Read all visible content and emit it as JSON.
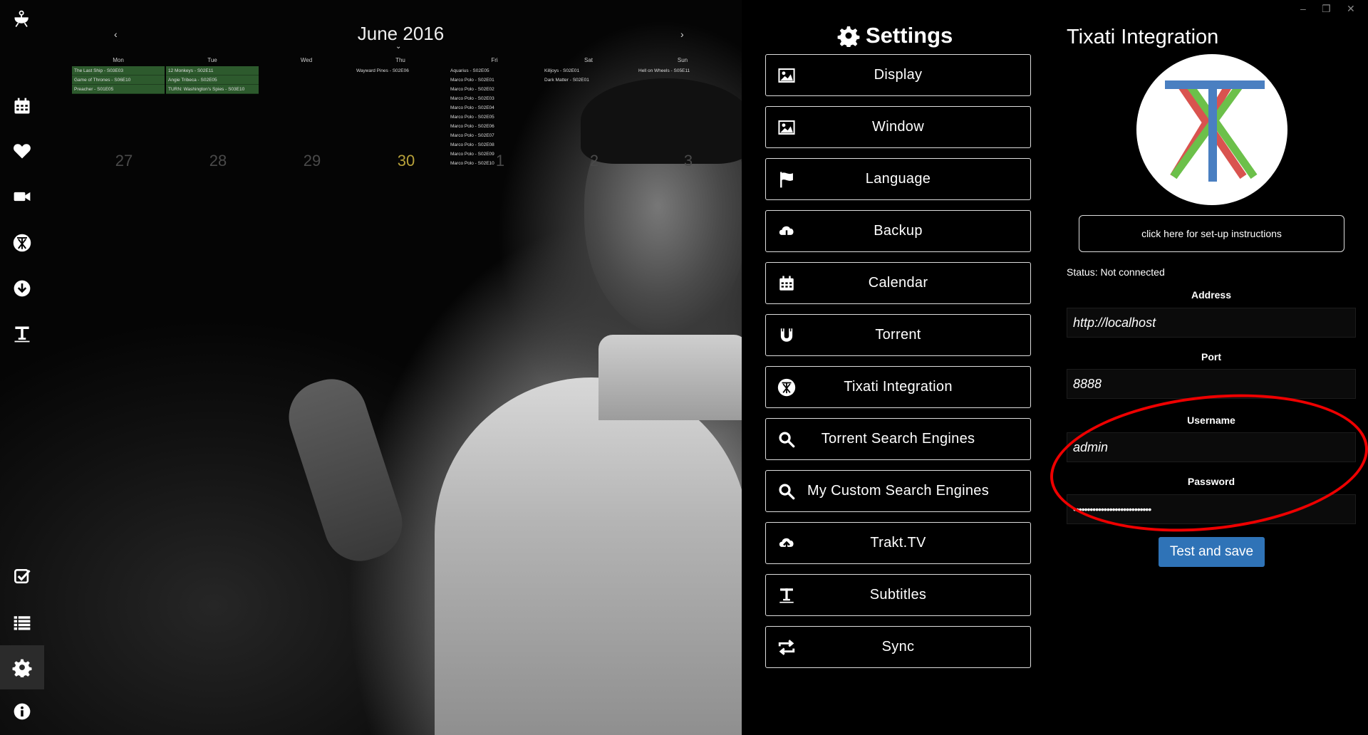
{
  "calendar": {
    "title": "June 2016",
    "prev": "‹",
    "next": "›",
    "caret": "⌄",
    "day_names": [
      "Mon",
      "Tue",
      "Wed",
      "Thu",
      "Fri",
      "Sat",
      "Sun"
    ],
    "events": [
      [
        {
          "text": "The Last Ship - S03E03",
          "hl": true
        },
        {
          "text": "Game of Thrones - S06E10",
          "hl": true
        },
        {
          "text": "Preacher - S01E05",
          "hl": true
        }
      ],
      [
        {
          "text": "12 Monkeys - S02E11",
          "hl": true
        },
        {
          "text": "Angie Tribeca - S02E05",
          "hl": true
        },
        {
          "text": "TURN: Washington's Spies - S03E10",
          "hl": true
        }
      ],
      [],
      [
        {
          "text": "Wayward Pines - S02E06",
          "hl": false
        }
      ],
      [
        {
          "text": "Aquarius - S02E05",
          "hl": false
        },
        {
          "text": "Marco Polo - S02E01",
          "hl": false
        },
        {
          "text": "Marco Polo - S02E02",
          "hl": false
        },
        {
          "text": "Marco Polo - S02E03",
          "hl": false
        },
        {
          "text": "Marco Polo - S02E04",
          "hl": false
        },
        {
          "text": "Marco Polo - S02E05",
          "hl": false
        },
        {
          "text": "Marco Polo - S02E06",
          "hl": false
        },
        {
          "text": "Marco Polo - S02E07",
          "hl": false
        },
        {
          "text": "Marco Polo - S02E08",
          "hl": false
        },
        {
          "text": "Marco Polo - S02E09",
          "hl": false
        },
        {
          "text": "Marco Polo - S02E10",
          "hl": false
        }
      ],
      [
        {
          "text": "Killjoys - S02E01",
          "hl": false
        },
        {
          "text": "Dark Matter - S02E01",
          "hl": false
        }
      ],
      [
        {
          "text": "Hell on Wheels - S05E11",
          "hl": false
        }
      ]
    ],
    "dates": [
      "27",
      "28",
      "29",
      "30",
      "1",
      "2",
      "3"
    ],
    "today_index": 3
  },
  "settings": {
    "title": "Settings",
    "items": [
      {
        "label": "Display",
        "icon": "image-icon"
      },
      {
        "label": "Window",
        "icon": "image-icon"
      },
      {
        "label": "Language",
        "icon": "flag-icon"
      },
      {
        "label": "Backup",
        "icon": "cloud-download-icon"
      },
      {
        "label": "Calendar",
        "icon": "calendar-icon"
      },
      {
        "label": "Torrent",
        "icon": "magnet-icon"
      },
      {
        "label": "Tixati Integration",
        "icon": "tixati-icon"
      },
      {
        "label": "Torrent Search Engines",
        "icon": "search-icon"
      },
      {
        "label": "My Custom Search Engines",
        "icon": "search-icon"
      },
      {
        "label": "Trakt.TV",
        "icon": "cloud-upload-icon"
      },
      {
        "label": "Subtitles",
        "icon": "text-icon"
      },
      {
        "label": "Sync",
        "icon": "sync-icon"
      }
    ]
  },
  "tixati": {
    "title": "Tixati Integration",
    "instructions": "click here for set-up instructions",
    "status": "Status: Not connected",
    "address_label": "Address",
    "address_value": "http://localhost",
    "port_label": "Port",
    "port_value": "8888",
    "username_label": "Username",
    "username_value": "admin",
    "password_label": "Password",
    "password_value": "••••••••••••••••••••••••••••",
    "save": "Test and save"
  },
  "window": {
    "minimize": "–",
    "restore": "❐",
    "close": "✕"
  },
  "colors": {
    "accent": "#2f73b7",
    "event_highlight": "#2d5a2d",
    "annotation": "#e00000",
    "today": "#b8a23a"
  }
}
